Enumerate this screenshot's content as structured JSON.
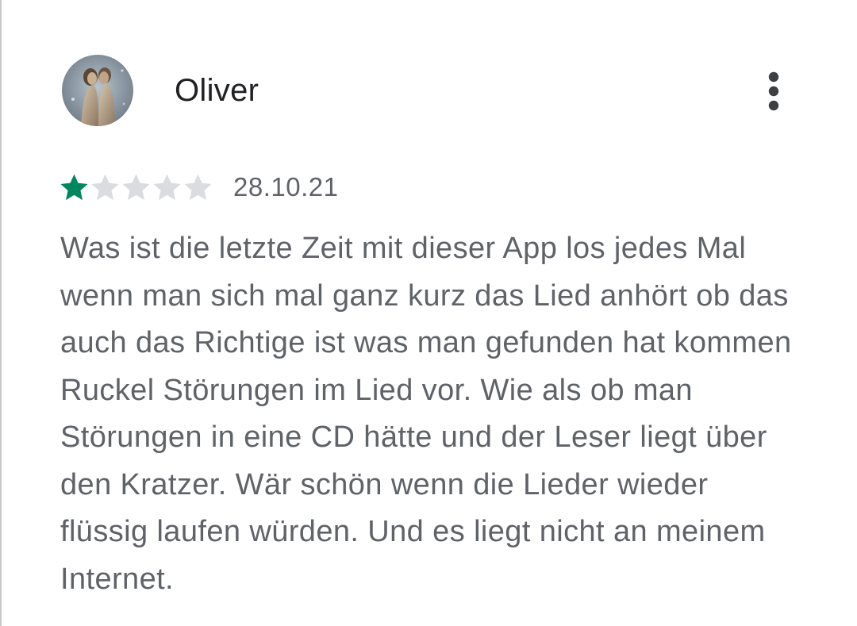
{
  "review": {
    "author": "Oliver",
    "rating": 1,
    "max_rating": 5,
    "date": "28.10.21",
    "text": "Was ist die letzte Zeit mit dieser App los jedes Mal wenn man sich mal ganz kurz das Lied anhört ob das auch das Richtige ist was man gefunden hat kommen Ruckel Störungen im Lied vor. Wie als ob man Störungen in eine CD hätte und der Leser liegt über den Kratzer. Wär schön wenn die Lieder wieder flüssig laufen würden. Und es liegt nicht an meinem Internet."
  },
  "icons": {
    "avatar": "avatar-image",
    "menu": "more-vert-icon",
    "star": "star-icon"
  },
  "colors": {
    "star_filled": "#01875f",
    "star_empty": "#dadce0",
    "author_text": "#202124",
    "body_text": "#5f6368"
  }
}
